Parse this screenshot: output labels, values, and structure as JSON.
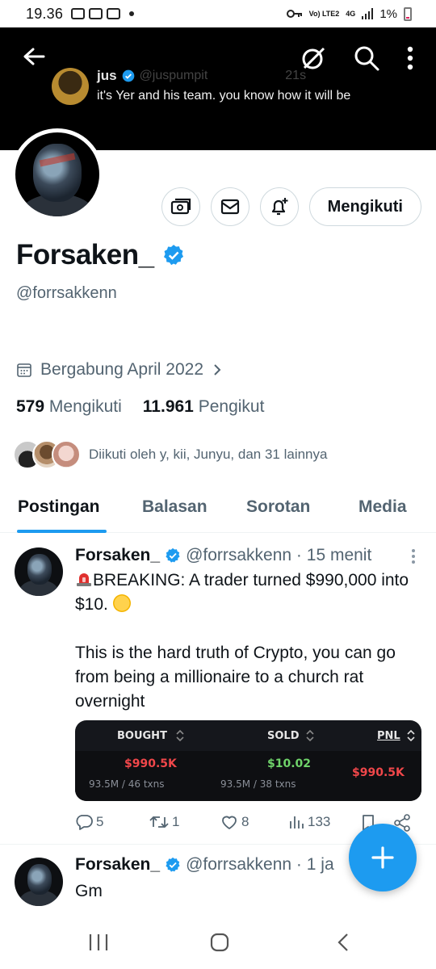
{
  "status_bar": {
    "time": "19.36",
    "network": "Vo) LTE2",
    "network_type": "4G",
    "battery": "1%"
  },
  "banner": {
    "preview_name": "jus",
    "preview_handle": "@juspumpit",
    "preview_time": "21s",
    "preview_text": "it's Yer and his team. you know how it will be"
  },
  "profile": {
    "display_name": "Forsaken_",
    "handle": "@forrsakkenn",
    "joined": "Bergabung April 2022",
    "following_count": "579",
    "following_label": "Mengikuti",
    "followers_count": "11.961",
    "followers_label": "Pengikut",
    "followed_by": "Diikuti oleh y, kii, Junyu, dan 31 lainnya",
    "follow_button": "Mengikuti"
  },
  "tabs": [
    {
      "label": "Postingan",
      "active": true
    },
    {
      "label": "Balasan",
      "active": false
    },
    {
      "label": "Sorotan",
      "active": false
    },
    {
      "label": "Media",
      "active": false
    }
  ],
  "tweets": [
    {
      "name": "Forsaken_",
      "meta": "@forrsakkenn · 15 menit",
      "text_lines": [
        "BREAKING: A trader turned $990,000 into $10.",
        "This is the hard truth of Crypto, you can go from being a millionaire to a church rat overnight"
      ],
      "card": {
        "headers": [
          "BOUGHT",
          "SOLD",
          "PNL"
        ],
        "bought_value": "$990.5K",
        "bought_sub": "93.5M / 46 txns",
        "sold_value": "$10.02",
        "sold_sub": "93.5M / 38 txns",
        "pnl_value": "$990.5K"
      },
      "replies": "5",
      "reposts": "1",
      "likes": "8",
      "views": "133"
    },
    {
      "name": "Forsaken_",
      "meta": "@forrsakkenn · 1 ja",
      "text_lines": [
        "Gm"
      ]
    }
  ],
  "colors": {
    "accent": "#1d9bf0",
    "loss": "#f0474a",
    "gain": "#6fd36a"
  }
}
